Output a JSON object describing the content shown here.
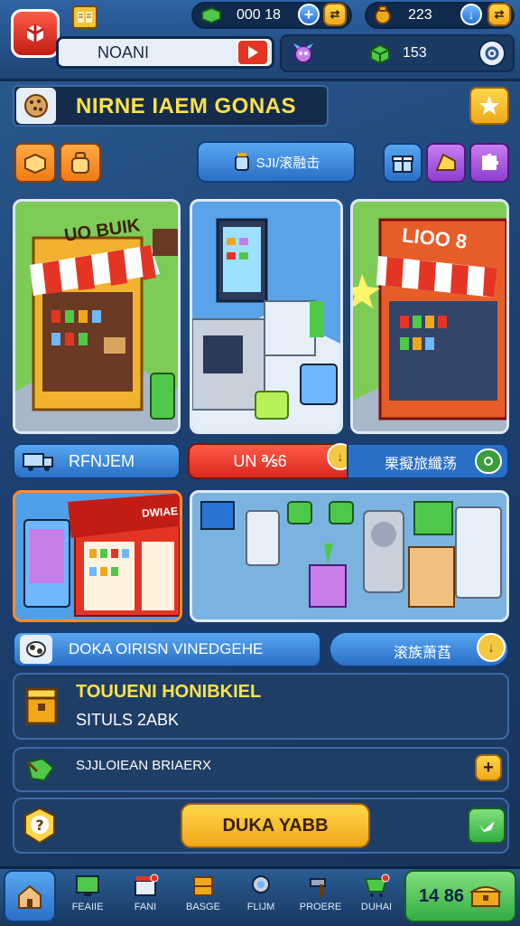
{
  "hud": {
    "cash": "000 18",
    "gold": "223",
    "player_name": "NOANI",
    "gems": "153"
  },
  "banner": {
    "title": "NIRNE IAEM GONAS"
  },
  "center_button": "SJI/滚融击",
  "section_a": {
    "left_label": "RFNJEM",
    "red_label": "UN ℁6",
    "right_label": "栗擬旅纖荡"
  },
  "shop_cards": [
    {
      "sign": "UO BUIK"
    },
    {
      "sign": ""
    },
    {
      "sign": "LIOO 8"
    }
  ],
  "wide_card": {
    "sign": "DWIAE"
  },
  "section_b": {
    "left_label": "DOKA OIRISN VINEDGEHE",
    "right_label": "滚族萧萏"
  },
  "info": {
    "title": "TOUUENI HONIBKIEL",
    "subtitle": "SITULS 2ABK"
  },
  "list_row": {
    "label": "SJJLOIEAN BRIAERX"
  },
  "cta": {
    "label": "DUKA YABB"
  },
  "bottom_nav": [
    {
      "label": "FEAIIE"
    },
    {
      "label": "FANI"
    },
    {
      "label": "BASGE"
    },
    {
      "label": "FLIJM"
    },
    {
      "label": "PROERE"
    },
    {
      "label": "DUHAI"
    }
  ],
  "bottom_right": {
    "value": "14 86"
  },
  "colors": {
    "accent_yellow": "#ffe14a",
    "panel": "#1f3e66",
    "red": "#d8291f",
    "green": "#33ad43"
  }
}
